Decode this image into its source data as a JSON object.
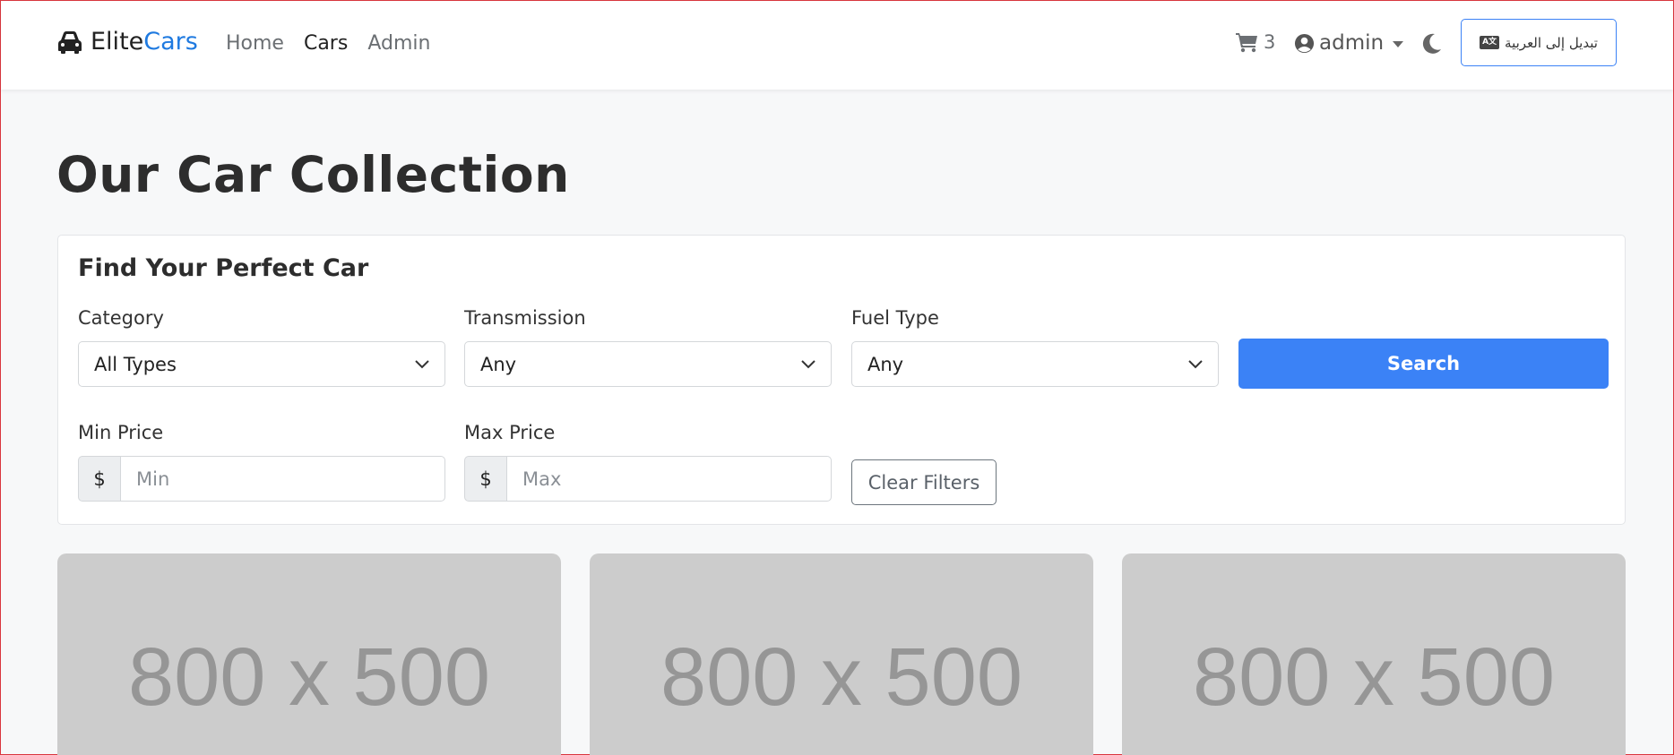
{
  "navbar": {
    "brand_part1": "Elite",
    "brand_part2": "Cars",
    "links": [
      {
        "label": "Home",
        "active": false
      },
      {
        "label": "Cars",
        "active": true
      },
      {
        "label": "Admin",
        "active": false
      }
    ],
    "cart_count": "3",
    "user_name": "admin",
    "lang_button": "تبديل إلى العربية",
    "icons": {
      "brand": "car-icon",
      "cart": "cart-icon",
      "user": "user-circle-icon",
      "theme": "moon-icon",
      "lang": "language-icon"
    }
  },
  "page": {
    "title": "Our Car Collection"
  },
  "filters": {
    "card_title": "Find Your Perfect Car",
    "category": {
      "label": "Category",
      "value": "All Types"
    },
    "transmission": {
      "label": "Transmission",
      "value": "Any"
    },
    "fuel_type": {
      "label": "Fuel Type",
      "value": "Any"
    },
    "search_button": "Search",
    "min_price": {
      "label": "Min Price",
      "addon": "$",
      "placeholder": "Min",
      "value": ""
    },
    "max_price": {
      "label": "Max Price",
      "addon": "$",
      "placeholder": "Max",
      "value": ""
    },
    "clear_button": "Clear Filters"
  },
  "cars": [
    {
      "image_placeholder": "800 x 500"
    },
    {
      "image_placeholder": "800 x 500"
    },
    {
      "image_placeholder": "800 x 500"
    }
  ],
  "colors": {
    "accent": "#1f7ae0",
    "primary_button": "#3b82f6",
    "page_bg": "#f7f8f9",
    "placeholder_bg": "#cccccc"
  }
}
